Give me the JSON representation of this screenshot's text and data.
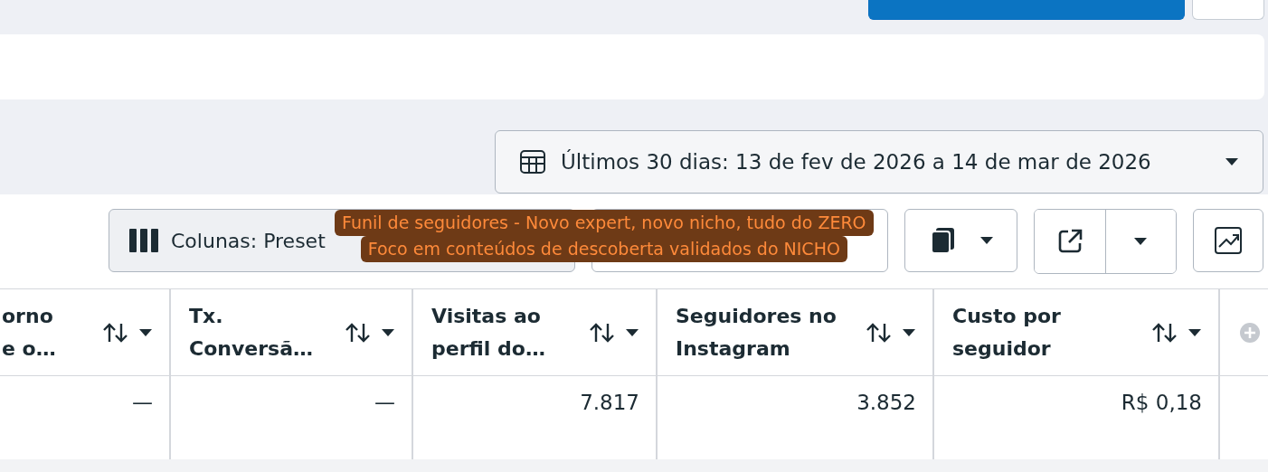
{
  "top_actions": [
    {
      "kind": "primary"
    },
    {
      "kind": "secondary"
    }
  ],
  "date_range": {
    "label": "Últimos 30 dias: 13 de fev de 2026 a 14 de mar de 2026"
  },
  "toolbar": {
    "columns_button": {
      "label": "Colunas: Preset"
    },
    "tooltip": {
      "lines": [
        "Funil de seguidores - Novo expert, novo nicho, tudo do ZERO",
        "Foco em conteúdos de descoberta validados do NICHO"
      ]
    }
  },
  "table": {
    "columns": [
      {
        "label_lines": [
          "orno",
          "e o…"
        ]
      },
      {
        "label_lines": [
          "Tx.",
          "Conversã…"
        ]
      },
      {
        "label_lines": [
          "Visitas ao",
          "perfil do…"
        ]
      },
      {
        "label_lines": [
          "Seguidores no",
          "Instagram"
        ]
      },
      {
        "label_lines": [
          "Custo por",
          "seguidor"
        ]
      }
    ],
    "rows": [
      {
        "cells": [
          "—",
          "—",
          "7.817",
          "3.852",
          "R$ 0,18"
        ]
      }
    ]
  }
}
